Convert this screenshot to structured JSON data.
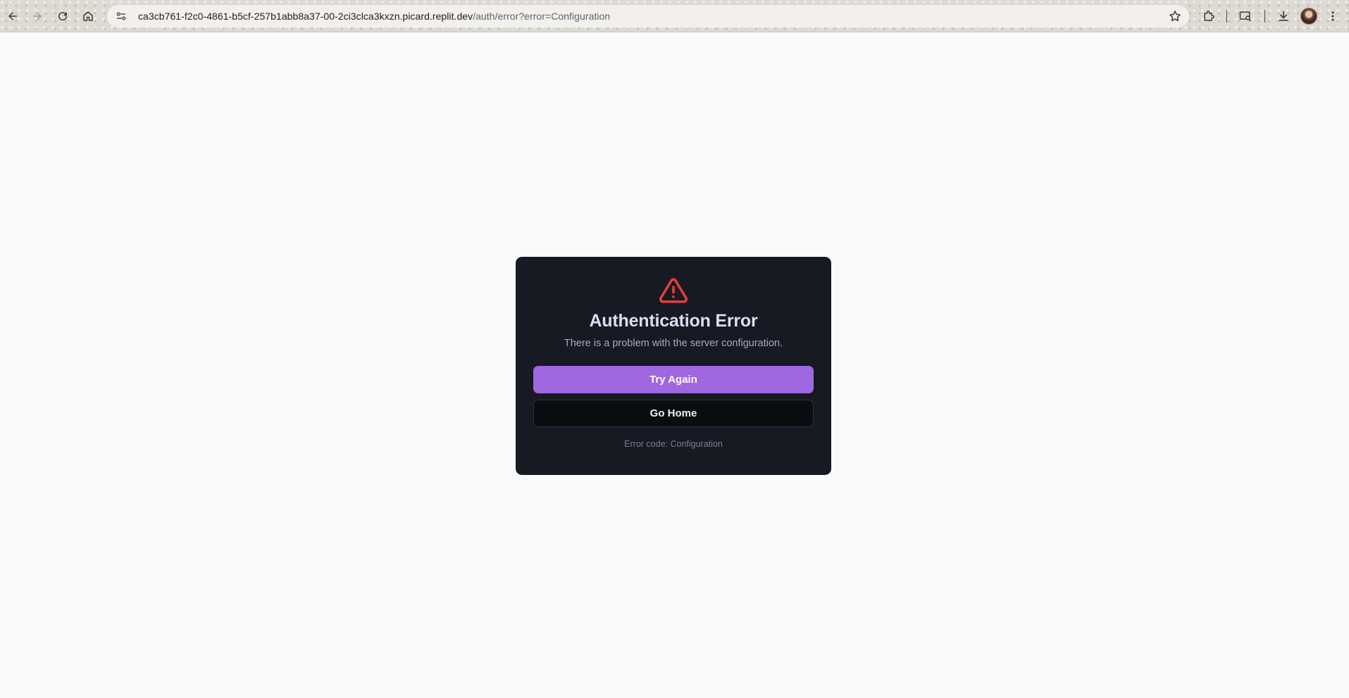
{
  "browser": {
    "url_host": "ca3cb761-f2c0-4861-b5cf-257b1abb8a37-00-2ci3clca3kxzn.picard.replit.dev",
    "url_path": "/auth/error?error=Configuration",
    "icons": {
      "back": "back-arrow-icon",
      "forward": "forward-arrow-icon",
      "reload": "reload-icon",
      "home": "home-icon",
      "site_info": "site-settings-icon",
      "bookmark": "star-icon",
      "extensions": "puzzle-icon",
      "cast": "cast-search-icon",
      "downloads": "download-icon",
      "profile": "avatar",
      "menu": "more-vertical-icon"
    }
  },
  "error_card": {
    "icon": "warning-triangle-icon",
    "title": "Authentication Error",
    "description": "There is a problem with the server configuration.",
    "try_again_label": "Try Again",
    "go_home_label": "Go Home",
    "error_code_text": "Error code: Configuration"
  },
  "colors": {
    "page_bg": "#f8fafc",
    "card_bg": "#171923",
    "primary": "#9f67e0",
    "warning": "#e53e3e"
  }
}
